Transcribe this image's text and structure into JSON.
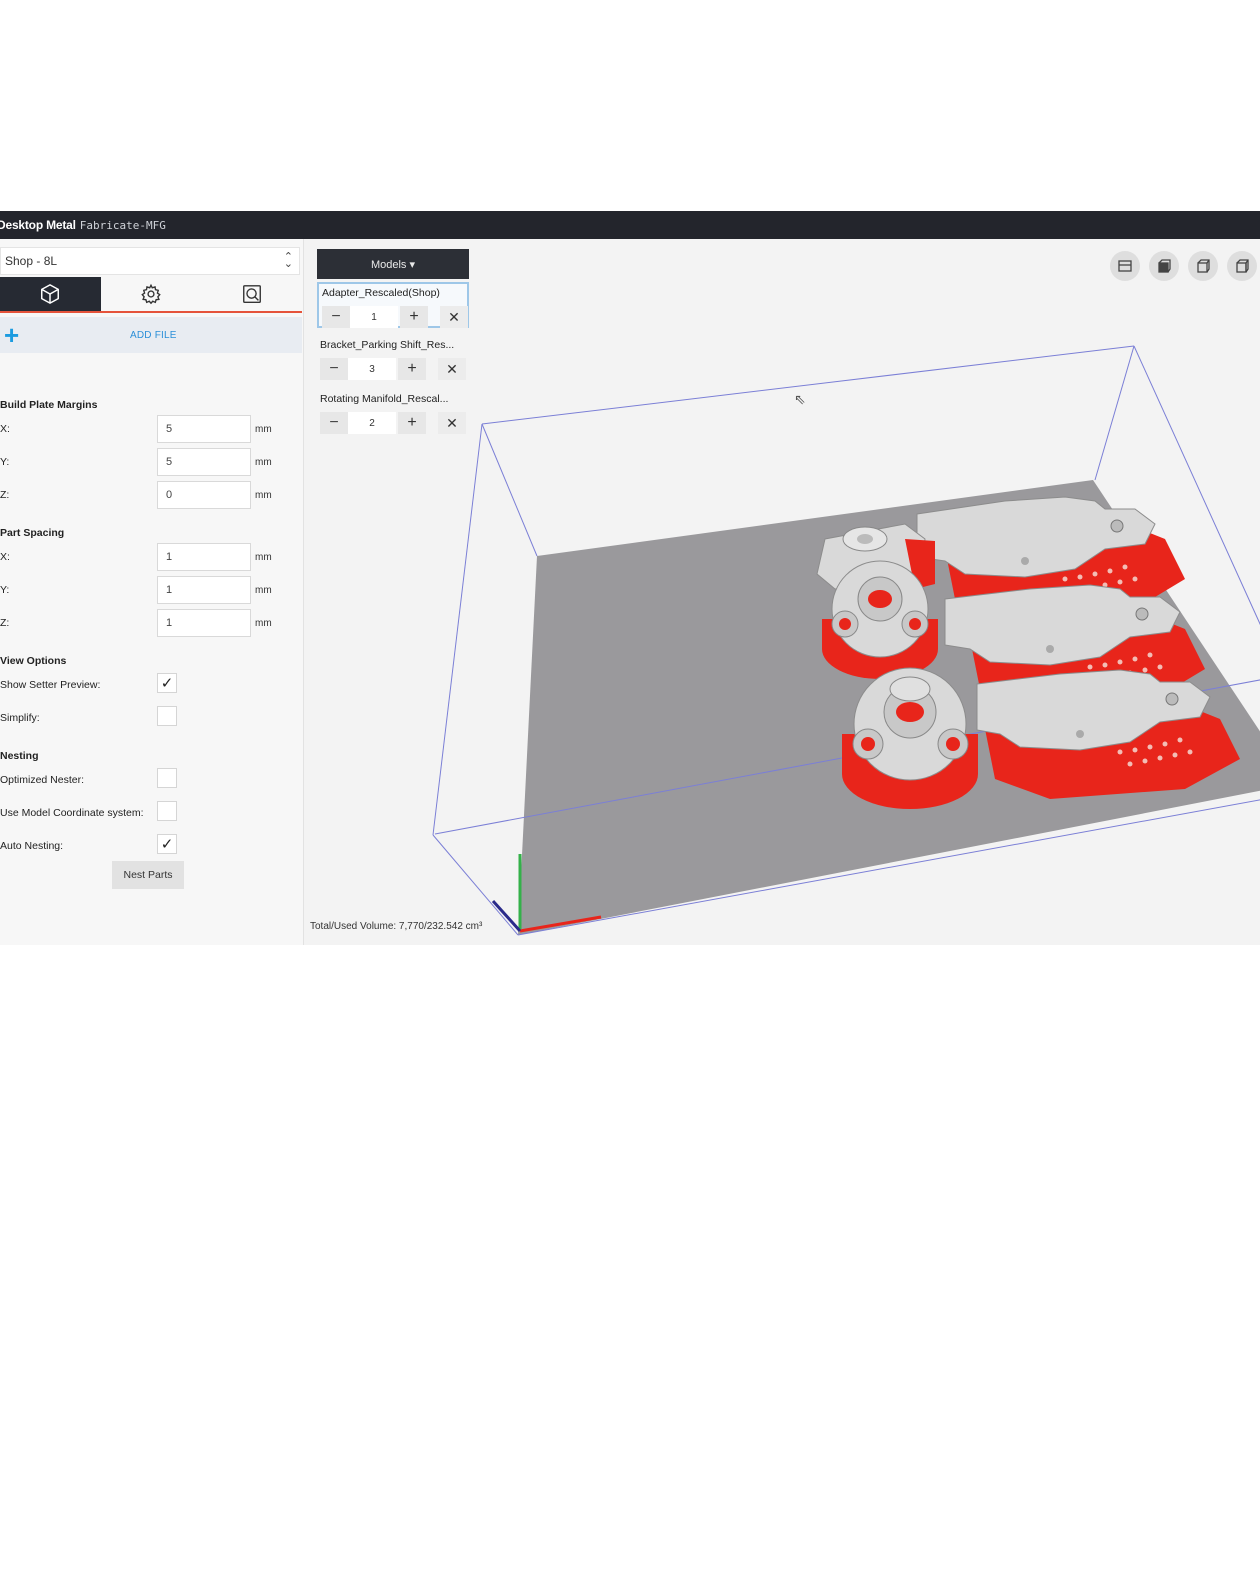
{
  "titlebar": {
    "brand": "Desktop Metal",
    "product": "Fabricate-MFG"
  },
  "sidebar": {
    "printer": "Shop - 8L",
    "tabs": [
      {
        "icon": "cube-icon",
        "active": true
      },
      {
        "icon": "gear-icon",
        "active": false
      },
      {
        "icon": "inspect-icon",
        "active": false
      }
    ],
    "add_file_label": "ADD FILE",
    "build_plate_margins": {
      "title": "Build Plate Margins",
      "rows": [
        {
          "label": "X:",
          "value": "5",
          "unit": "mm"
        },
        {
          "label": "Y:",
          "value": "5",
          "unit": "mm"
        },
        {
          "label": "Z:",
          "value": "0",
          "unit": "mm"
        }
      ]
    },
    "part_spacing": {
      "title": "Part Spacing",
      "rows": [
        {
          "label": "X:",
          "value": "1",
          "unit": "mm"
        },
        {
          "label": "Y:",
          "value": "1",
          "unit": "mm"
        },
        {
          "label": "Z:",
          "value": "1",
          "unit": "mm"
        }
      ]
    },
    "view_options": {
      "title": "View Options",
      "rows": [
        {
          "label": "Show Setter Preview:",
          "checked": true
        },
        {
          "label": "Simplify:",
          "checked": false
        }
      ]
    },
    "nesting": {
      "title": "Nesting",
      "rows": [
        {
          "label": "Optimized Nester:",
          "checked": false
        },
        {
          "label": "Use Model Coordinate system:",
          "checked": false
        },
        {
          "label": "Auto Nesting:",
          "checked": true
        }
      ]
    },
    "nest_button": "Nest Parts"
  },
  "viewport": {
    "models_button": "Models ▾",
    "models": [
      {
        "name": "Adapter_Rescaled(Shop)",
        "qty": "1",
        "selected": true
      },
      {
        "name": "Bracket_Parking Shift_Res...",
        "qty": "3",
        "selected": false
      },
      {
        "name": "Rotating Manifold_Rescal...",
        "qty": "2",
        "selected": false
      }
    ],
    "view_buttons": [
      "top-view-icon",
      "front-view-icon",
      "side-view-icon",
      "iso-view-icon"
    ],
    "volume_label": "Total/Used Volume: 7,770/232.542 cm³",
    "colors": {
      "support": "#e8251b",
      "part": "#d9d9d9",
      "plate": "#9a999c",
      "bbox": "#7b7fd6"
    }
  }
}
